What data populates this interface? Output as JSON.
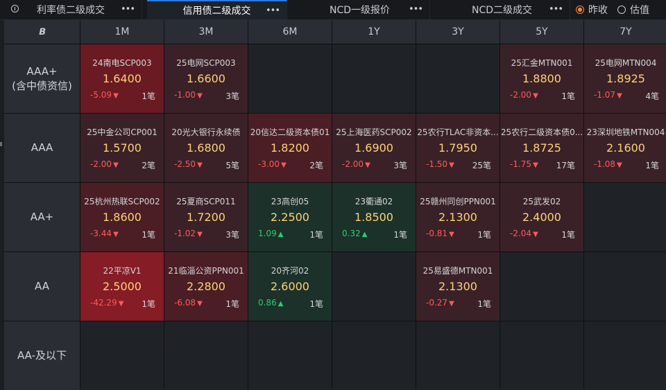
{
  "tabs": [
    {
      "label": "利率债二级成交",
      "active": false
    },
    {
      "label": "信用债二级成交",
      "active": true
    },
    {
      "label": "NCD一级报价",
      "active": false
    },
    {
      "label": "NCD二级成交",
      "active": false
    }
  ],
  "more_glyph": "•••",
  "radios": [
    {
      "label": "昨收",
      "checked": true
    },
    {
      "label": "估值",
      "checked": false
    }
  ],
  "grid": {
    "corner_logo": "B",
    "columns": [
      "1M",
      "3M",
      "6M",
      "1Y",
      "3Y",
      "5Y",
      "7Y"
    ],
    "rows": [
      {
        "label_lines": [
          "AAA+",
          "(含中债资信)"
        ],
        "cells": [
          {
            "name": "24南电SCP003",
            "price": "1.6400",
            "change": "-5.09",
            "dir": "down",
            "count": "1笔",
            "shade": "up3"
          },
          {
            "name": "25电网SCP003",
            "price": "1.6600",
            "change": "-1.00",
            "dir": "down",
            "count": "3笔",
            "shade": "up1"
          },
          null,
          null,
          null,
          {
            "name": "25汇金MTN001",
            "price": "1.8800",
            "change": "-2.00",
            "dir": "down",
            "count": "1笔",
            "shade": "up1"
          },
          {
            "name": "25电网MTN004",
            "price": "1.8925",
            "change": "-1.07",
            "dir": "down",
            "count": "4笔",
            "shade": "up1"
          }
        ]
      },
      {
        "label_lines": [
          "AAA"
        ],
        "cells": [
          {
            "name": "25中金公司CP001",
            "price": "1.5700",
            "change": "-2.00",
            "dir": "down",
            "count": "2笔",
            "shade": "up1"
          },
          {
            "name": "20光大银行永续债",
            "price": "1.6800",
            "change": "-2.50",
            "dir": "down",
            "count": "5笔",
            "shade": "up1"
          },
          {
            "name": "20信达二级资本债01",
            "price": "1.8200",
            "change": "-3.00",
            "dir": "down",
            "count": "2笔",
            "shade": "up2"
          },
          {
            "name": "25上海医药SCP002",
            "price": "1.6900",
            "change": "-2.00",
            "dir": "down",
            "count": "3笔",
            "shade": "up1"
          },
          {
            "name": "25农行TLAC非资本...",
            "price": "1.7950",
            "change": "-1.50",
            "dir": "down",
            "count": "25笔",
            "shade": "up1"
          },
          {
            "name": "25农行二级资本债0...",
            "price": "1.8725",
            "change": "-1.75",
            "dir": "down",
            "count": "17笔",
            "shade": "up1"
          },
          {
            "name": "23深圳地铁MTN004",
            "price": "2.1600",
            "change": "-1.08",
            "dir": "down",
            "count": "1笔",
            "shade": "up1"
          }
        ]
      },
      {
        "label_lines": [
          "AA+"
        ],
        "cells": [
          {
            "name": "25杭州热联SCP002",
            "price": "1.8600",
            "change": "-3.44",
            "dir": "down",
            "count": "1笔",
            "shade": "up2"
          },
          {
            "name": "25夏商SCP011",
            "price": "1.7200",
            "change": "-1.02",
            "dir": "down",
            "count": "3笔",
            "shade": "up1"
          },
          {
            "name": "23高创05",
            "price": "2.2500",
            "change": "1.09",
            "dir": "up",
            "count": "1笔",
            "shade": "dn1"
          },
          {
            "name": "23衢通02",
            "price": "1.8500",
            "change": "0.32",
            "dir": "up",
            "count": "1笔",
            "shade": "dn1"
          },
          {
            "name": "25赣州同创PPN001",
            "price": "2.1300",
            "change": "-0.81",
            "dir": "down",
            "count": "1笔",
            "shade": "up1"
          },
          {
            "name": "25武发02",
            "price": "2.4000",
            "change": "-2.04",
            "dir": "down",
            "count": "1笔",
            "shade": "up1"
          },
          null
        ]
      },
      {
        "label_lines": [
          "AA"
        ],
        "cells": [
          {
            "name": "22平凉V1",
            "price": "2.5000",
            "change": "-42.29",
            "dir": "down",
            "count": "1笔",
            "shade": "up4"
          },
          {
            "name": "21临淄公资PPN001",
            "price": "2.2800",
            "change": "-6.08",
            "dir": "down",
            "count": "1笔",
            "shade": "up2"
          },
          {
            "name": "20齐河02",
            "price": "2.6000",
            "change": "0.86",
            "dir": "up",
            "count": "1笔",
            "shade": "dn1"
          },
          null,
          {
            "name": "25易盛德MTN001",
            "price": "2.1300",
            "change": "-0.27",
            "dir": "down",
            "count": "1笔",
            "shade": "up1"
          },
          null,
          null
        ]
      },
      {
        "label_lines": [
          "AA-及以下"
        ],
        "cells": [
          null,
          null,
          null,
          null,
          null,
          null,
          null
        ]
      }
    ]
  },
  "colors": {
    "price": "#ffd27a",
    "negative": "#ff5a5a",
    "positive": "#2ecc71",
    "radio_accent": "#ff8a3d",
    "active_tab_accent": "#2d7be0"
  },
  "icons": {
    "info": "info-icon",
    "more": "more-icon",
    "logo": "logo-icon",
    "up": "triangle-up-icon",
    "down": "triangle-down-icon"
  }
}
